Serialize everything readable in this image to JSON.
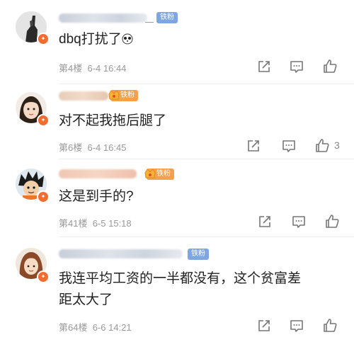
{
  "comments": [
    {
      "badge": "铁粉",
      "content": "dbq打扰了",
      "emoji": "🐼",
      "floor": "第4楼",
      "time": "6-4 16:44",
      "likes": ""
    },
    {
      "badge": "铁粉",
      "content": "对不起我拖后腿了",
      "floor": "第6楼",
      "time": "6-4 16:45",
      "likes": "3"
    },
    {
      "badge": "铁粉",
      "content": "这是到手的?",
      "floor": "第41楼",
      "time": "6-5 15:18",
      "likes": ""
    },
    {
      "badge": "铁粉",
      "content_line1": "我连平均工资的一半都没有，这个贫富差",
      "content_line2": "距太大了",
      "floor": "第64楼",
      "time": "6-6 14:21",
      "likes": ""
    }
  ],
  "colors": {
    "fan_badge_blue": "#7ea6e2",
    "fan_badge_orange": "#f5a04d",
    "avatar_badge": "#f26b2f"
  },
  "icons": [
    "share-icon",
    "comment-icon",
    "like-icon",
    "fan-badge-crown-icon",
    "avatar-badge-icon"
  ]
}
